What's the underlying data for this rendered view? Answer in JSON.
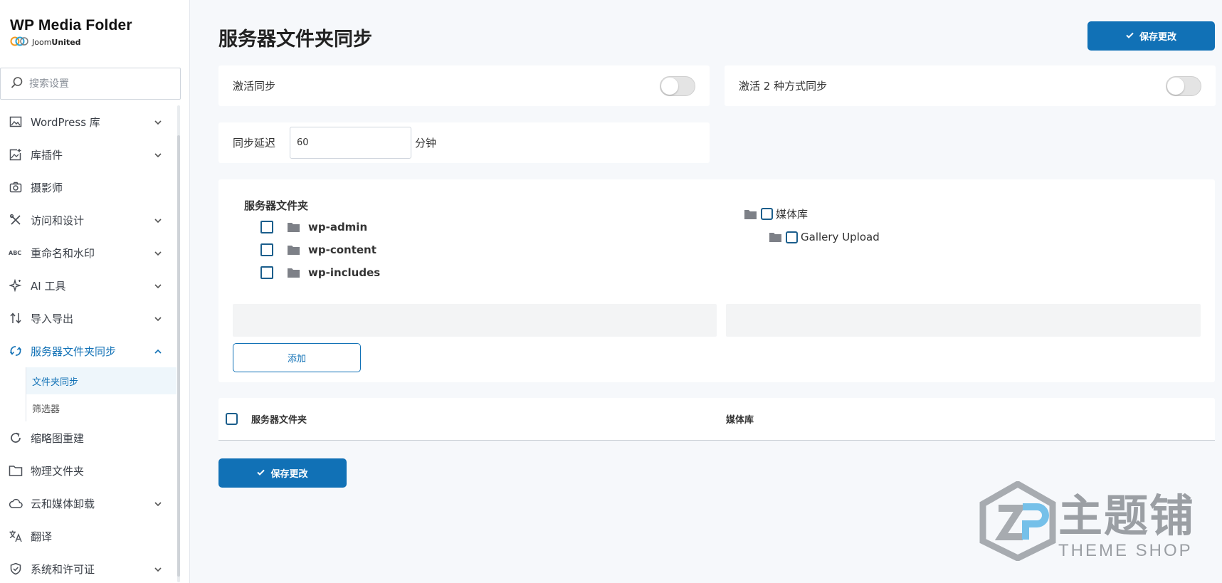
{
  "brand": {
    "title": "WP Media Folder",
    "sub_light": "Joom",
    "sub_bold": "United"
  },
  "search": {
    "placeholder": "搜索设置"
  },
  "sidebar": {
    "items": [
      {
        "label": "WordPress 库",
        "icon": "image-icon"
      },
      {
        "label": "库插件",
        "icon": "image-add-icon"
      },
      {
        "label": "摄影师",
        "icon": "camera-icon"
      },
      {
        "label": "访问和设计",
        "icon": "tools-icon"
      },
      {
        "label": "重命名和水印",
        "icon": "abc-icon"
      },
      {
        "label": "AI 工具",
        "icon": "sparkles-icon"
      },
      {
        "label": "导入导出",
        "icon": "arrows-updown-icon"
      },
      {
        "label": "服务器文件夹同步",
        "icon": "sync-icon"
      },
      {
        "label": "缩略图重建",
        "icon": "refresh-icon"
      },
      {
        "label": "物理文件夹",
        "icon": "folder-icon"
      },
      {
        "label": "云和媒体卸载",
        "icon": "cloud-icon"
      },
      {
        "label": "翻译",
        "icon": "translate-icon"
      },
      {
        "label": "系统和许可证",
        "icon": "shield-check-icon"
      }
    ],
    "sub_items": [
      "文件夹同步",
      "筛选器"
    ]
  },
  "main": {
    "title": "服务器文件夹同步",
    "save_label": "保存更改",
    "activate_sync": "激活同步",
    "activate_2way": "激活 2 种方式同步",
    "sync_delay_label": "同步延迟",
    "sync_delay_value": "60",
    "sync_delay_unit": "分钟",
    "server_folder_title": "服务器文件夹",
    "server_folders": [
      "wp-admin",
      "wp-content",
      "wp-includes"
    ],
    "media_library": "媒体库",
    "gallery_upload": "Gallery Upload",
    "add_label": "添加",
    "table_col_server": "服务器文件夹",
    "table_col_media": "媒体库"
  },
  "watermark": {
    "cn": "主题铺",
    "en": "THEME SHOP"
  },
  "colors": {
    "accent": "#1171b6",
    "checkbox": "#1b5e8c"
  }
}
